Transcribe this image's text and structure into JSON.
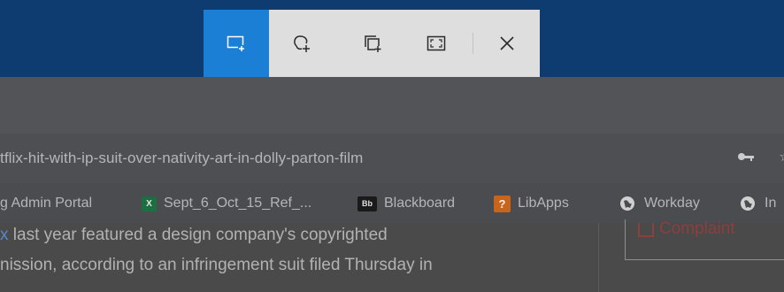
{
  "address_bar": {
    "url_text": "tflix-hit-with-ip-suit-over-nativity-art-in-dolly-parton-film",
    "icons": [
      "key-icon",
      "star-icon"
    ]
  },
  "bookmarks": [
    {
      "label": "g Admin Portal",
      "icon": "none"
    },
    {
      "label": "Sept_6_Oct_15_Ref_...",
      "icon": "excel-icon",
      "icon_text": "X"
    },
    {
      "label": "Blackboard",
      "icon": "blackboard-icon",
      "icon_text": "Bb"
    },
    {
      "label": "LibApps",
      "icon": "libapps-icon",
      "icon_text": "?"
    },
    {
      "label": "Workday",
      "icon": "globe-icon"
    },
    {
      "label": "In",
      "icon": "globe-icon"
    }
  ],
  "article": {
    "line1_link": "x",
    "line1_rest": " last year featured a design company's copyrighted",
    "line2": "nission, according to an infringement suit filed Thursday in"
  },
  "sidebar": {
    "box_text": "Complaint"
  },
  "snip_toolbar": {
    "modes": [
      "rectangular-snip",
      "freeform-snip",
      "window-snip",
      "fullscreen-snip"
    ],
    "active_mode": "rectangular-snip",
    "accent_color": "#1c7fd6"
  },
  "colors": {
    "title_bar": "#0e3c70",
    "toolbar_bg": "#dedede",
    "link": "#5a86c6"
  }
}
